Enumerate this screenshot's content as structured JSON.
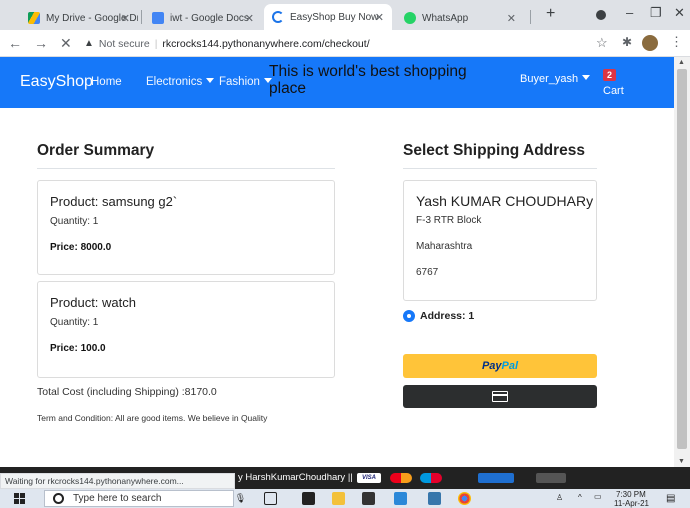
{
  "browser": {
    "tabs": [
      {
        "title": "My Drive - Google Driv",
        "active": false
      },
      {
        "title": "iwt - Google Docs",
        "active": false
      },
      {
        "title": "EasyShop Buy Now",
        "active": true
      },
      {
        "title": "WhatsApp",
        "active": false
      }
    ],
    "new_tab_label": "+",
    "window_controls": {
      "minimize": "–",
      "maximize": "❐",
      "close": "✕"
    },
    "nav": {
      "back": "←",
      "forward": "→",
      "stop": "✕"
    },
    "security_label": "Not secure",
    "separator": "|",
    "url": "rkcrocks144.pythonanywhere.com/checkout/",
    "status_text": "Waiting for rkcrocks144.pythonanywhere.com..."
  },
  "navbar": {
    "brand": "EasyShop",
    "links": [
      {
        "label": "Home",
        "dropdown": false
      },
      {
        "label": "Electronics",
        "dropdown": true
      },
      {
        "label": "Fashion",
        "dropdown": true
      }
    ],
    "tagline": "This is world's best shopping place",
    "user": "Buyer_yash",
    "cart_count": "2",
    "cart_label": "Cart"
  },
  "order_summary": {
    "title": "Order Summary",
    "items": [
      {
        "product": "Product: samsung g2`",
        "quantity": "Quantity: 1",
        "price": "Price: 8000.0"
      },
      {
        "product": "Product: watch",
        "quantity": "Quantity: 1",
        "price": "Price: 100.0"
      }
    ],
    "total": "Total Cost (including Shipping) :8170.0",
    "terms": "Term and Condition: All are good items. We believe in Quality"
  },
  "shipping": {
    "title": "Select Shipping Address",
    "address": {
      "name": "Yash KUMAR CHOUDHARy",
      "line1": "F-3 RTR Block",
      "state": "Maharashtra",
      "pin": "6767"
    },
    "radio_label": "Address: 1",
    "paypal_part1": "Pay",
    "paypal_part2": "Pal"
  },
  "footer": {
    "text": "y HarshKumarChoudhary ||",
    "pay_logos": [
      "VISA",
      "",
      "",
      "",
      ""
    ]
  },
  "taskbar": {
    "search_placeholder": "Type here to search",
    "time": "7:30 PM",
    "date": "11-Apr-21"
  },
  "colors": {
    "navbar": "#1678f9",
    "paypal_yellow": "#ffc439",
    "badge_red": "#dc3545",
    "footer": "#222222"
  }
}
